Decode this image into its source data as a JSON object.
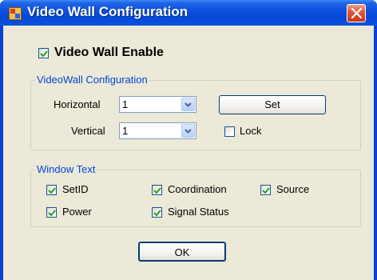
{
  "window": {
    "title": "Video Wall Configuration"
  },
  "enable": {
    "label": "Video Wall Enable",
    "checked": true
  },
  "config_group": {
    "title": "VideoWall Configuration",
    "horizontal_label": "Horizontal",
    "horizontal_value": "1",
    "vertical_label": "Vertical",
    "vertical_value": "1",
    "set_label": "Set",
    "lock_label": "Lock",
    "lock_checked": false
  },
  "text_group": {
    "title": "Window Text",
    "setid_label": "SetID",
    "coordination_label": "Coordination",
    "source_label": "Source",
    "power_label": "Power",
    "signal_label": "Signal Status"
  },
  "ok_label": "OK",
  "colors": {
    "title_bar": "#0a4fdd",
    "group_title": "#0046d5",
    "dialog_bg": "#ece9d8",
    "close": "#e05a3c"
  }
}
